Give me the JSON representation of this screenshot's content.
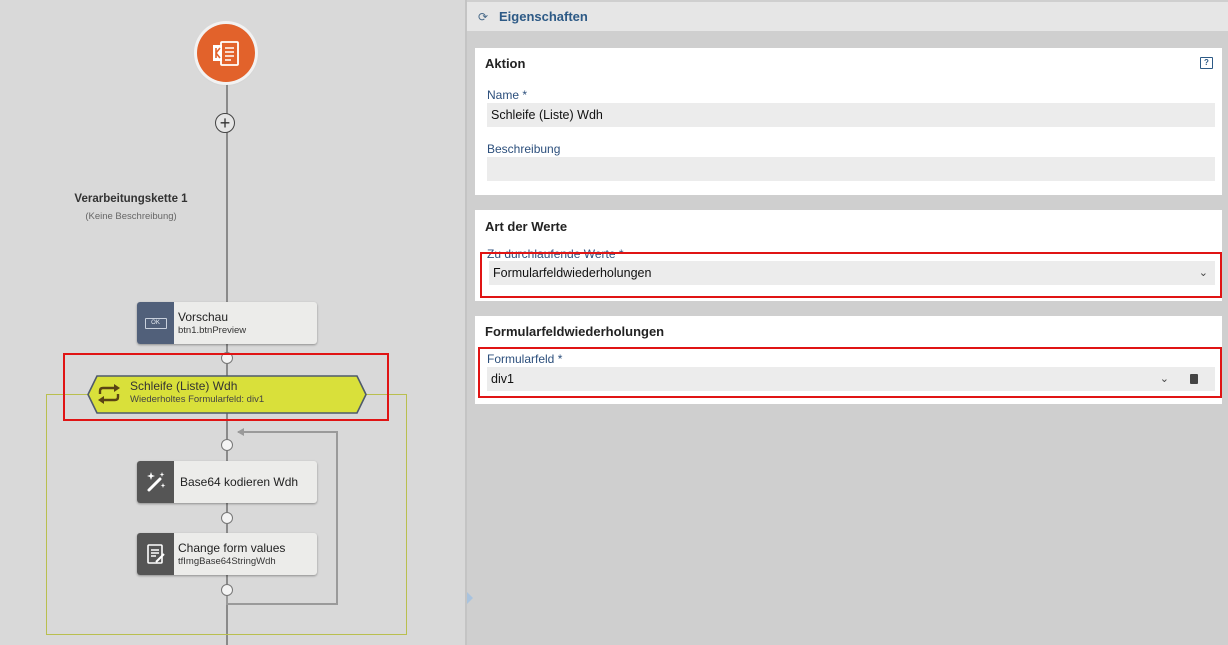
{
  "workflow": {
    "chain_title": "Verarbeitungskette 1",
    "chain_description": "(Keine Beschreibung)",
    "add_symbol": "+",
    "nodes": [
      {
        "title": "Vorschau",
        "subtitle": "btn1.btnPreview",
        "icon_text": "OK",
        "icon": "button-icon"
      },
      {
        "title": "Schleife (Liste) Wdh",
        "subtitle": "Wiederholtes Formularfeld: div1",
        "icon": "loop-icon"
      },
      {
        "title": "Base64 kodieren Wdh",
        "icon": "magic-wand-icon"
      },
      {
        "title": "Change form values",
        "subtitle": "tfImgBase64StringWdh",
        "icon": "form-edit-icon"
      }
    ],
    "colors": {
      "start": "#e2622b",
      "loop": "#d9e03a",
      "node_icon": "#51607a"
    }
  },
  "panel": {
    "title": "Eigenschaften",
    "help_icon_text": "?",
    "sections": {
      "aktion": {
        "title": "Aktion",
        "name_label": "Name",
        "required_mark": "*",
        "name_value": "Schleife (Liste) Wdh",
        "description_label": "Beschreibung",
        "description_value": ""
      },
      "art": {
        "title": "Art der Werte",
        "values_label": "Zu durchlaufende Werte",
        "required_mark": "*",
        "values_selected": "Formularfeldwiederholungen"
      },
      "wiederholungen": {
        "title": "Formularfeldwiederholungen",
        "field_label": "Formularfeld",
        "required_mark": "*",
        "field_value": "div1"
      }
    }
  }
}
